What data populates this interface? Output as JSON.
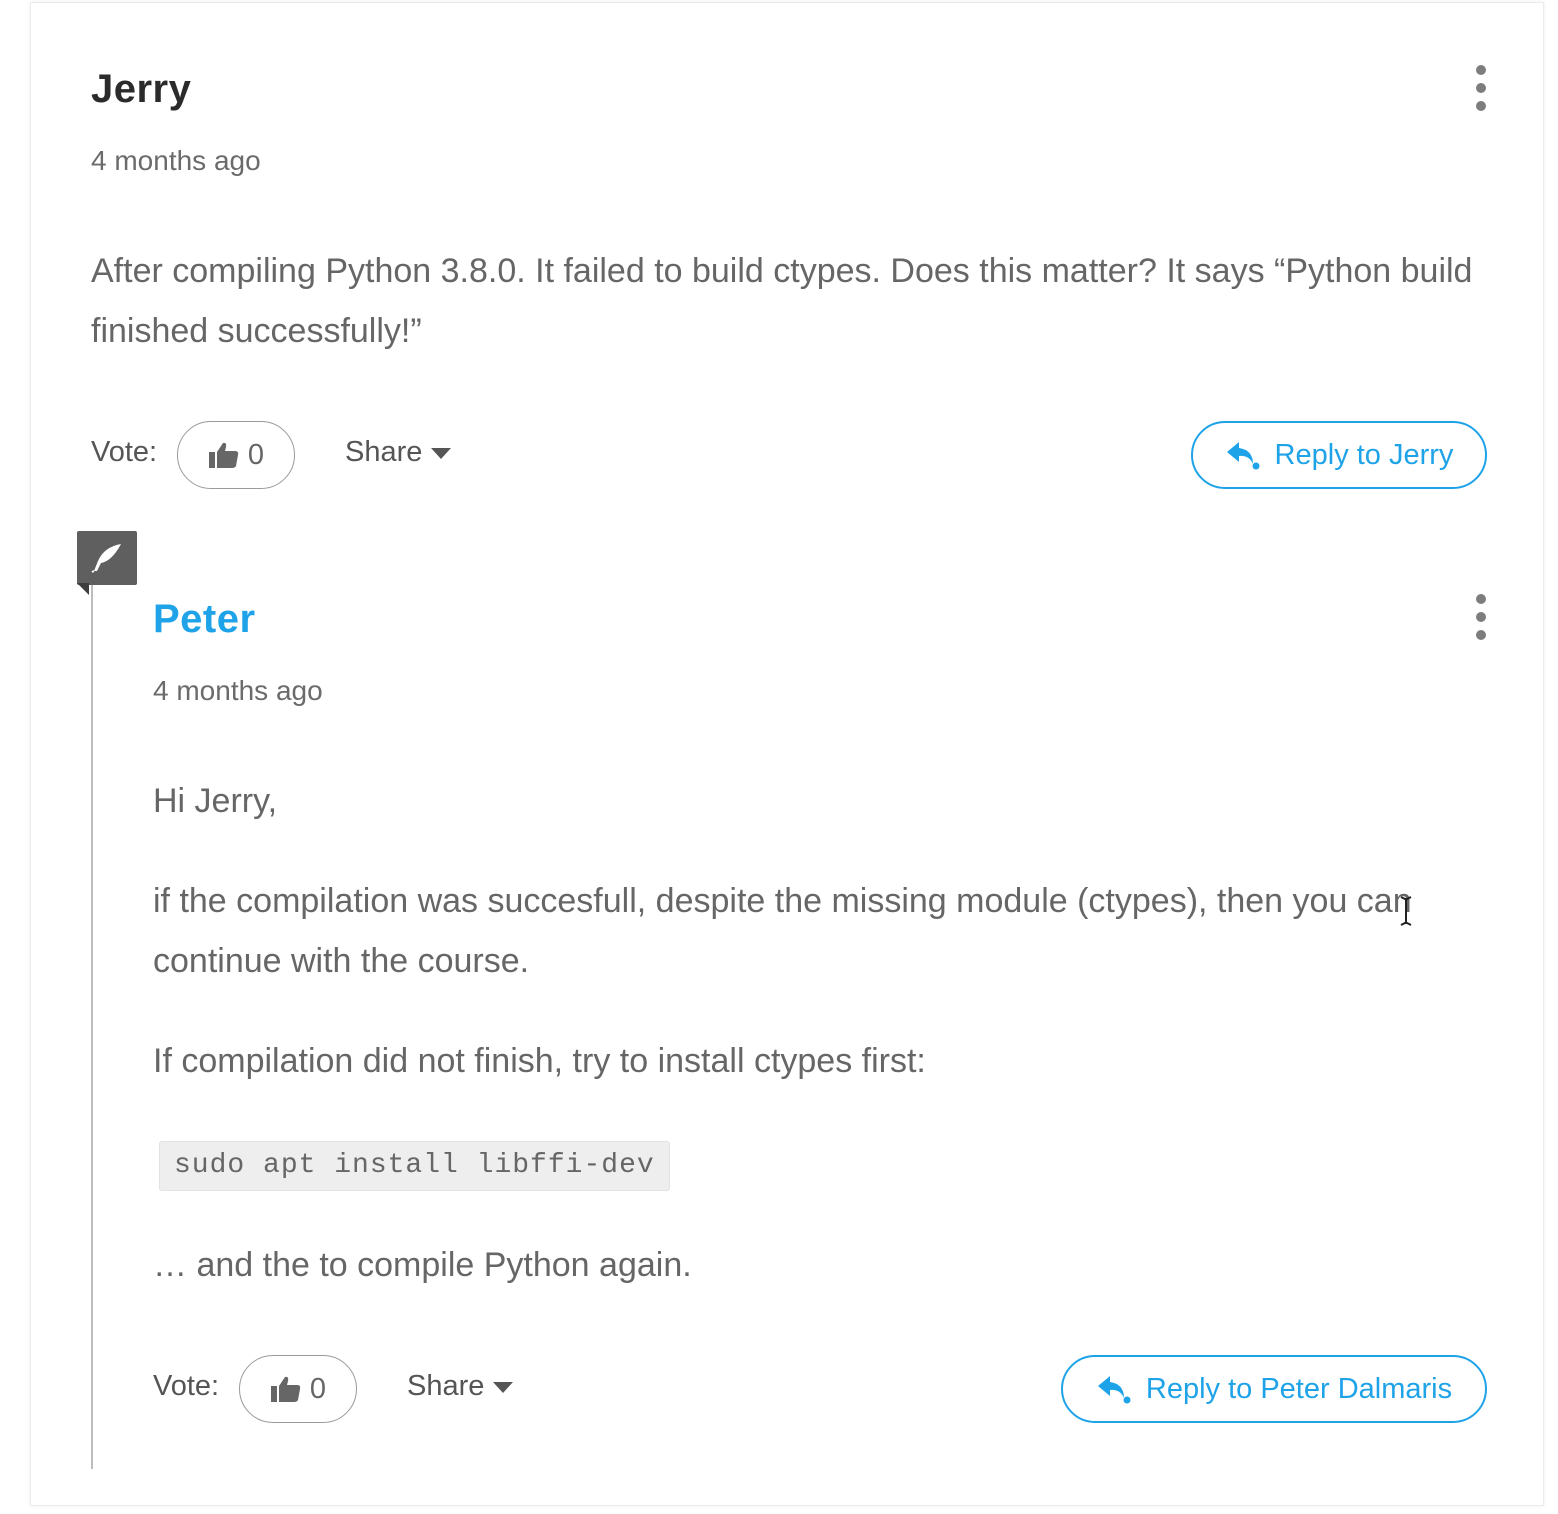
{
  "comment": {
    "author": "Jerry",
    "time": "4 months ago",
    "text": "After compiling Python 3.8.0. It failed to build ctypes. Does this matter? It says “Python build finished successfully!”",
    "vote_label": "Vote:",
    "vote_count": "0",
    "share_label": "Share",
    "reply_label": "Reply to Jerry"
  },
  "reply": {
    "author": "Peter",
    "time": "4 months ago",
    "greeting": "Hi Jerry,",
    "paragraph1": "if the compilation was succesfull, despite the missing module (ctypes), then you can continue with the course.",
    "paragraph2": "If compilation did not finish, try to install ctypes first:",
    "code": "sudo apt install libffi-dev",
    "paragraph3": "… and the to compile Python again.",
    "vote_label": "Vote:",
    "vote_count": "0",
    "share_label": "Share",
    "reply_label": "Reply to Peter Dalmaris"
  },
  "colors": {
    "accent": "#1fa3e8",
    "badge": "#5f5f5f",
    "text": "#666666"
  },
  "icons": [
    "kebab-menu-icon",
    "thumbs-up-icon",
    "caret-down-icon",
    "reply-arrow-icon",
    "quill-icon",
    "text-cursor-icon"
  ]
}
